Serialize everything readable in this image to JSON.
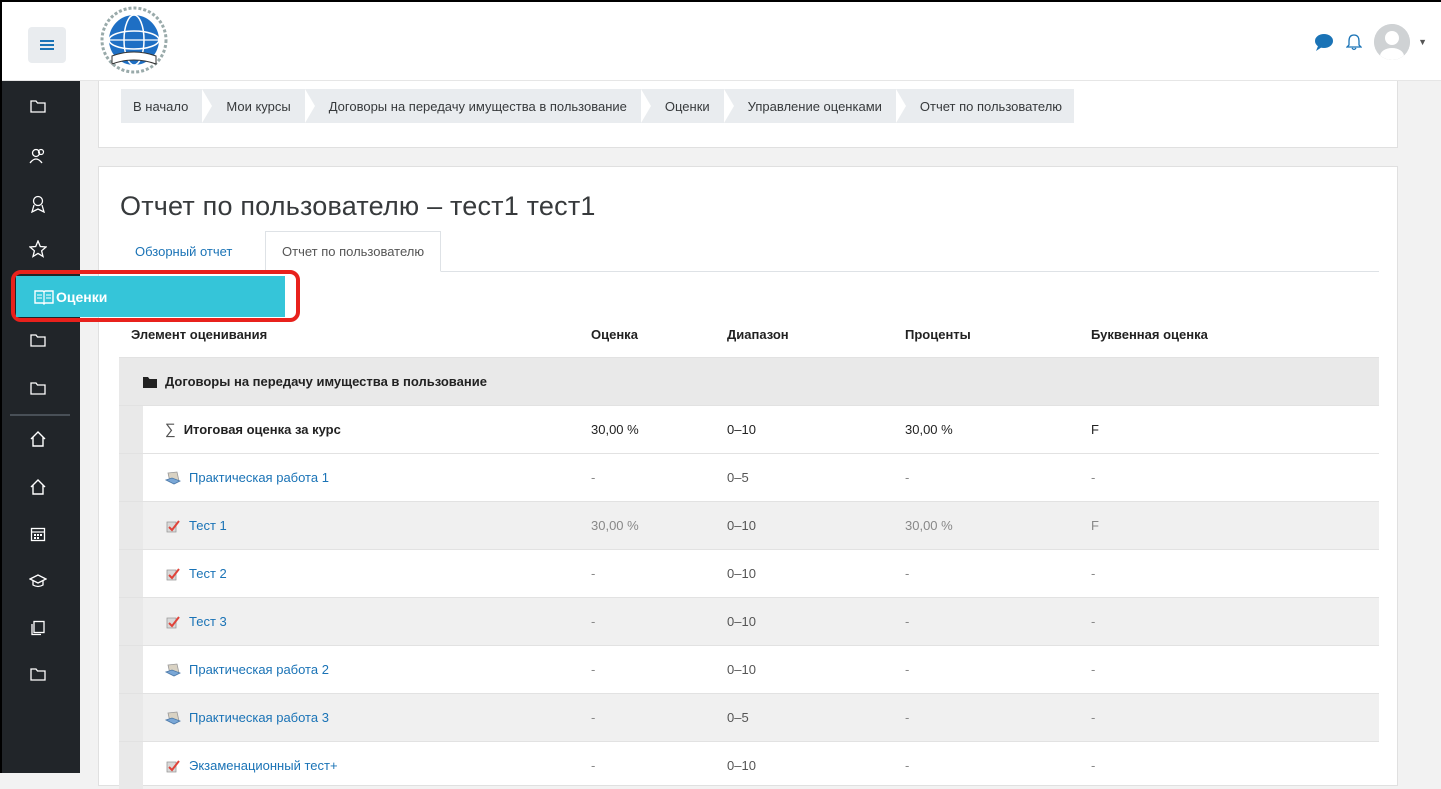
{
  "nav": {
    "menu_icon": "hamburger-icon",
    "chat_icon": "chat-bubble-icon",
    "bell_icon": "bell-icon",
    "caret": "▼"
  },
  "sidebar": {
    "grades_label": "Оценки",
    "items": [
      "folder-icon",
      "participants-icon",
      "badges-icon",
      "competencies-icon",
      "book-icon",
      "folder-icon",
      "folder-icon",
      "home-icon",
      "home-icon",
      "calendar-icon",
      "graduation-cap-icon",
      "files-icon",
      "folder-icon"
    ]
  },
  "breadcrumb": [
    "В начало",
    "Мои курсы",
    "Договоры на передачу имущества в пользование",
    "Оценки",
    "Управление оценками",
    "Отчет по пользователю"
  ],
  "page": {
    "title": "Отчет по пользователю – тест1 тест1"
  },
  "tabs": {
    "overview": "Обзорный отчет",
    "user": "Отчет по пользователю"
  },
  "table": {
    "headers": {
      "item": "Элемент оценивания",
      "grade": "Оценка",
      "range": "Диапазон",
      "percent": "Проценты",
      "letter": "Буквенная оценка"
    },
    "category": "Договоры на передачу имущества в пользование",
    "total": {
      "name": "Итоговая оценка за курс",
      "grade": "30,00 %",
      "range": "0–10",
      "percent": "30,00 %",
      "letter": "F"
    },
    "rows": [
      {
        "name": "Практическая работа 1",
        "icon": "assignment-icon",
        "grade": "-",
        "range": "0–5",
        "percent": "-",
        "letter": "-"
      },
      {
        "name": "Тест 1",
        "icon": "quiz-icon",
        "grade": "30,00 %",
        "range": "0–10",
        "percent": "30,00 %",
        "letter": "F"
      },
      {
        "name": "Тест 2",
        "icon": "quiz-icon",
        "grade": "-",
        "range": "0–10",
        "percent": "-",
        "letter": "-"
      },
      {
        "name": "Тест 3",
        "icon": "quiz-icon",
        "grade": "-",
        "range": "0–10",
        "percent": "-",
        "letter": "-"
      },
      {
        "name": "Практическая работа 2",
        "icon": "assignment-icon",
        "grade": "-",
        "range": "0–10",
        "percent": "-",
        "letter": "-"
      },
      {
        "name": "Практическая работа 3",
        "icon": "assignment-icon",
        "grade": "-",
        "range": "0–5",
        "percent": "-",
        "letter": "-"
      },
      {
        "name": "Экзаменационный тест+",
        "icon": "quiz-icon",
        "grade": "-",
        "range": "0–10",
        "percent": "-",
        "letter": "-"
      }
    ]
  },
  "colors": {
    "link": "#1a73b6",
    "sidebar": "#212529",
    "highlight": "#35c5d9",
    "annotation": "#e8211c"
  }
}
